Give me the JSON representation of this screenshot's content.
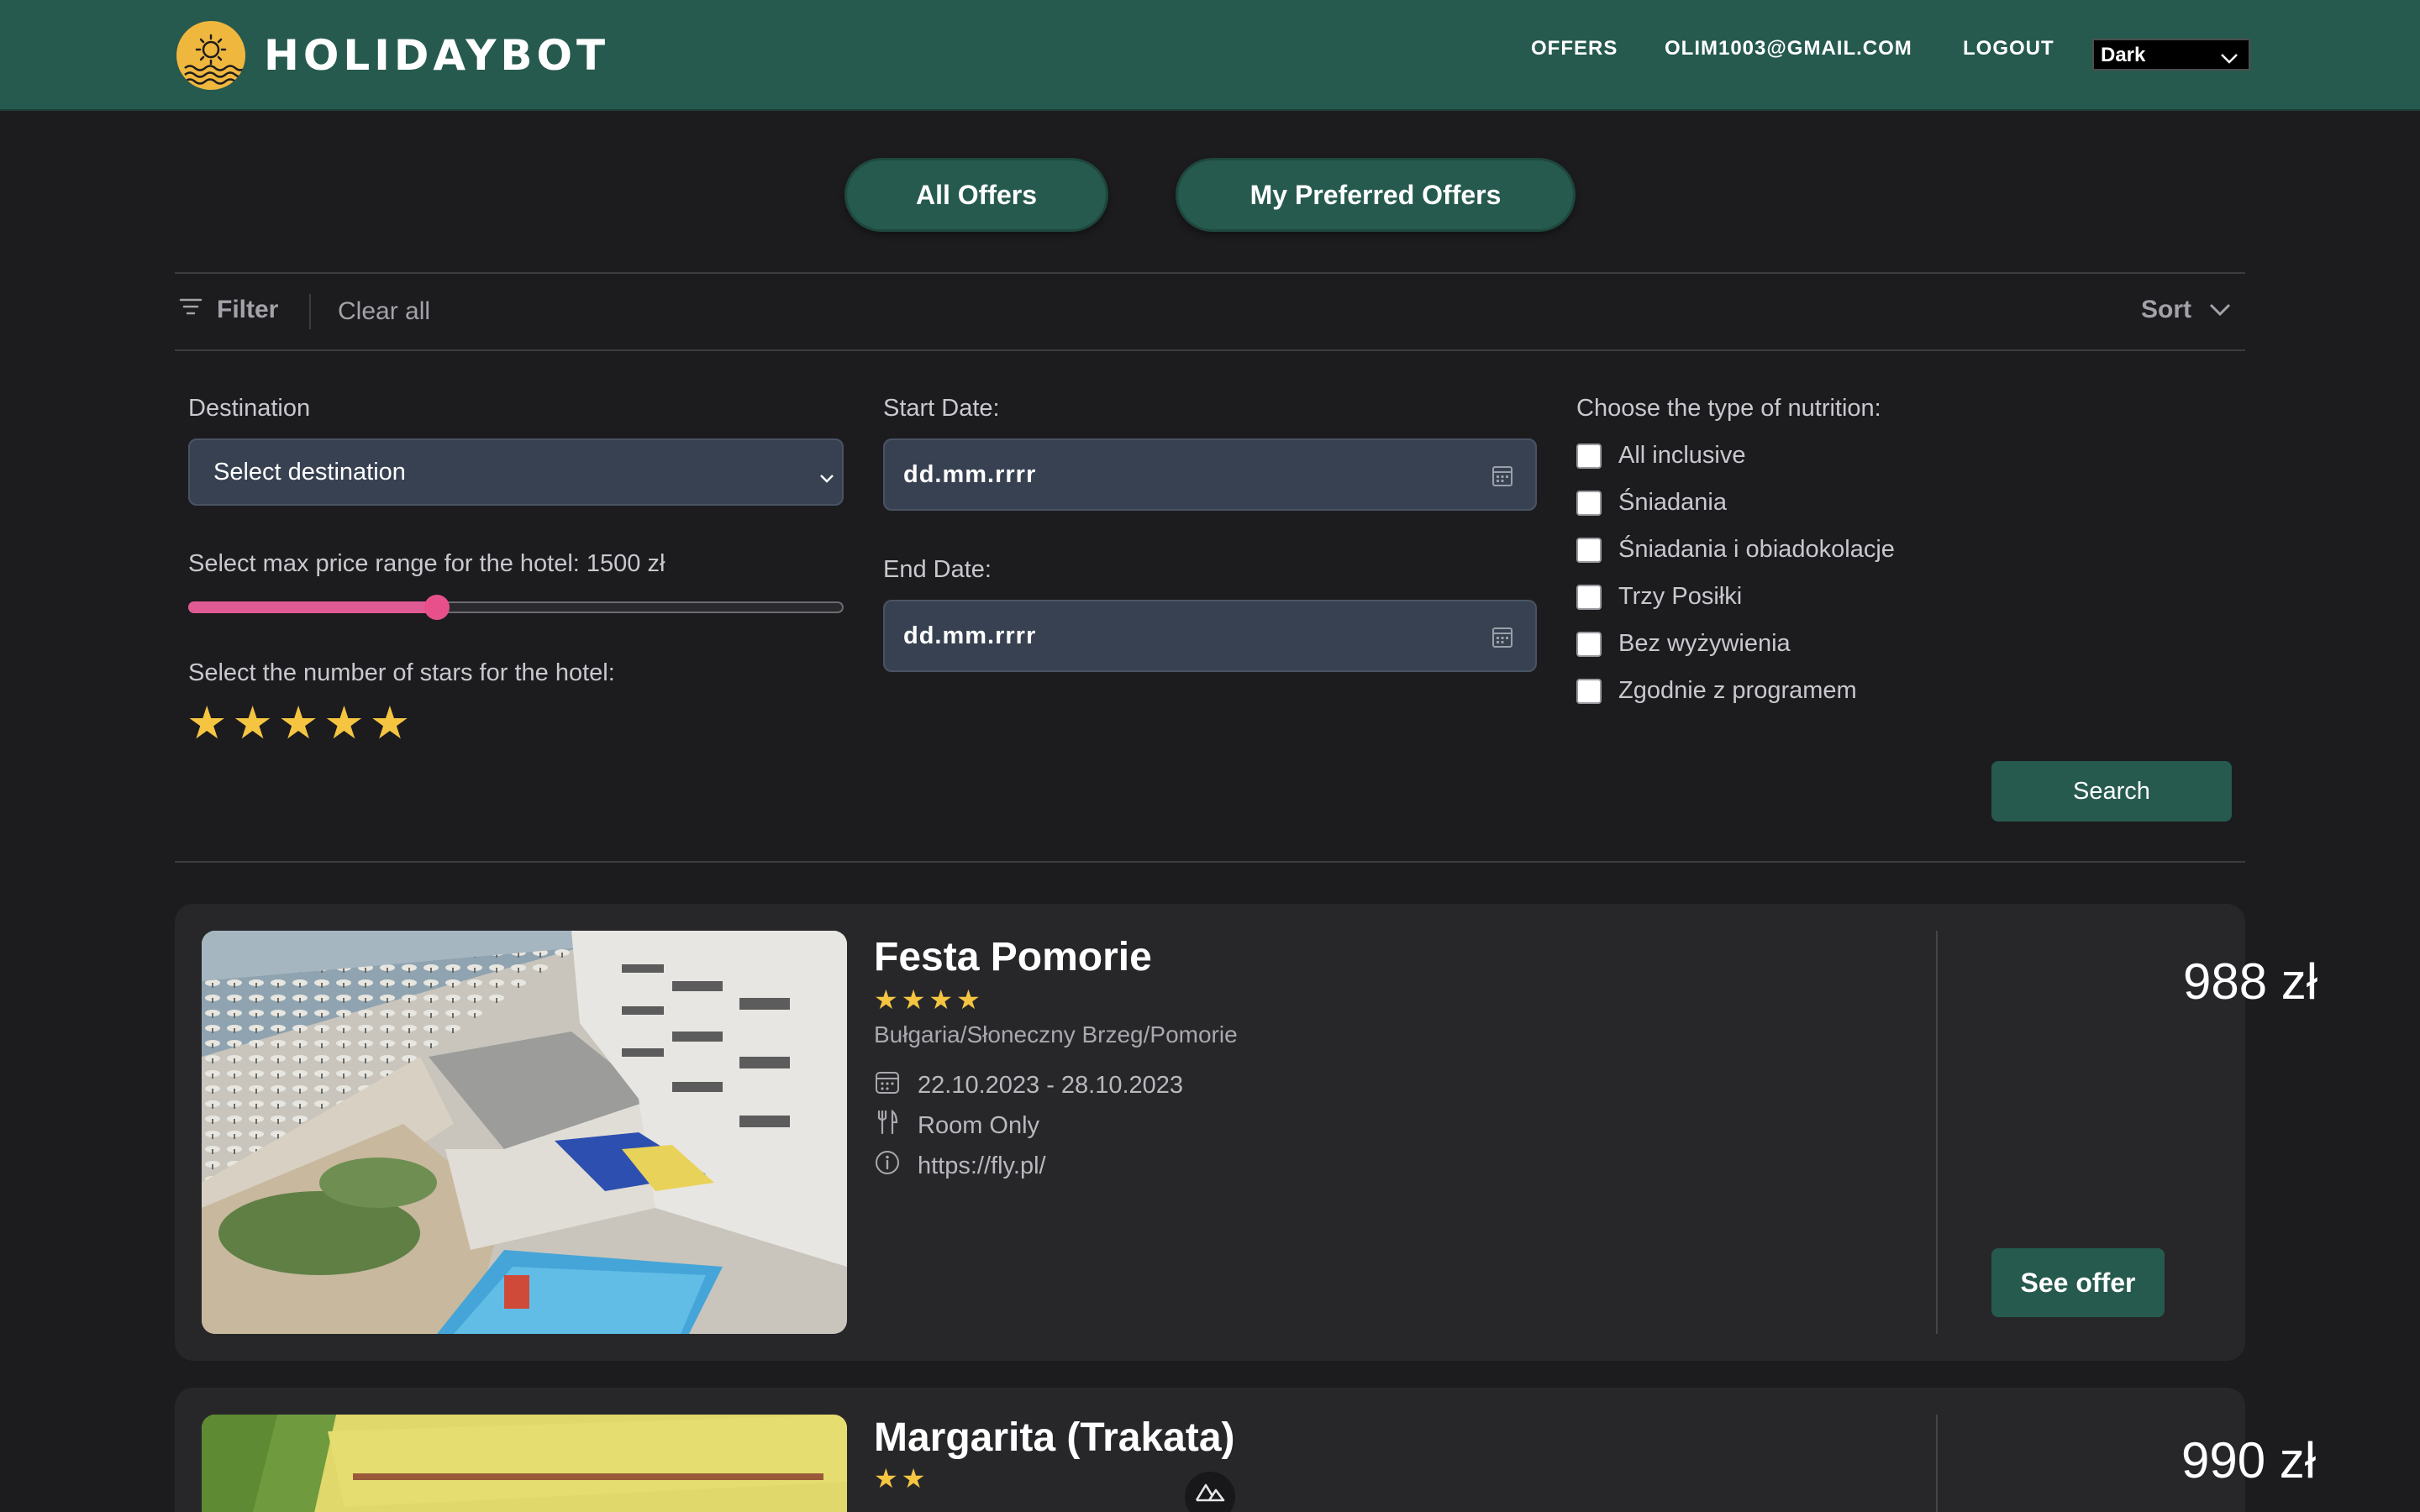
{
  "app": {
    "name": "HOLIDAYBOT"
  },
  "nav": {
    "offers": "OFFERS",
    "email": "OLIM1003@GMAIL.COM",
    "logout": "LOGOUT",
    "theme_value": "Dark"
  },
  "tabs": {
    "all": "All Offers",
    "preferred": "My Preferred Offers"
  },
  "filter_bar": {
    "filter": "Filter",
    "clear": "Clear all",
    "sort": "Sort"
  },
  "form": {
    "destination_label": "Destination",
    "destination_value": "Select destination",
    "price_label": "Select max price range for the hotel: 1500 zł",
    "price_fraction": 0.38,
    "stars_label": "Select the number of stars for the hotel:",
    "stars_selected": 5,
    "start_label": "Start Date:",
    "start_placeholder": "dd.mm.rrrr",
    "end_label": "End Date:",
    "end_placeholder": "dd.mm.rrrr",
    "nutrition_label": "Choose the type of nutrition:",
    "nutrition_options": [
      "All inclusive",
      "Śniadania",
      "Śniadania i obiadokolacje",
      "Trzy Posiłki",
      "Bez wyżywienia",
      "Zgodnie z programem"
    ],
    "search": "Search"
  },
  "offers": [
    {
      "name": "Festa Pomorie",
      "stars": 4,
      "location": "Bułgaria/Słoneczny Brzeg/Pomorie",
      "dates": "22.10.2023 - 28.10.2023",
      "board": "Room Only",
      "link": "https://fly.pl/",
      "price": "988 zł",
      "cta": "See offer"
    },
    {
      "name": "Margarita (Trakata)",
      "stars": 2,
      "location": "",
      "price": "990 zł"
    }
  ],
  "colors": {
    "brand": "#265a4e",
    "background": "#1c1c1f",
    "card": "#27272a",
    "star": "#f5c542",
    "slider": "#e05a93"
  }
}
